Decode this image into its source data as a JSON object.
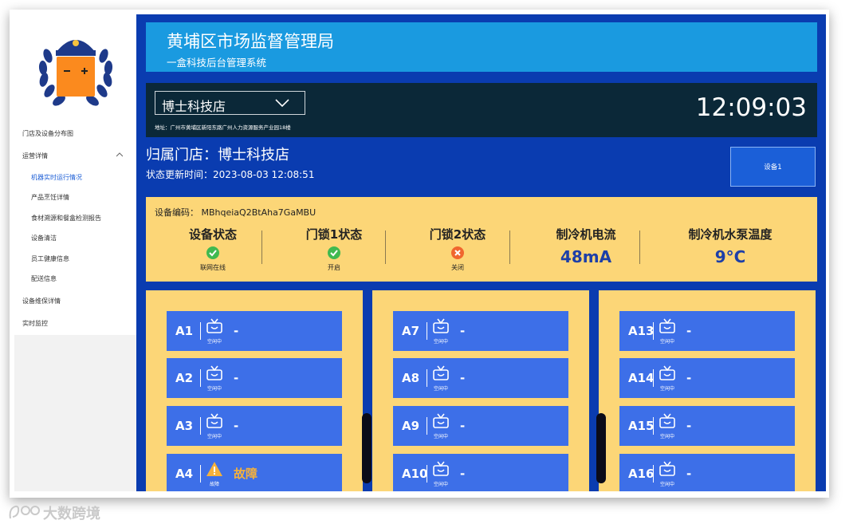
{
  "sidebar": {
    "items": [
      {
        "label": "门店及设备分布图",
        "level": 1,
        "active": false
      },
      {
        "label": "运营详情",
        "level": 1,
        "active": false,
        "expanded": true
      },
      {
        "label": "机器实时运行情况",
        "level": 2,
        "active": true
      },
      {
        "label": "产品烹饪详情",
        "level": 2,
        "active": false
      },
      {
        "label": "食材溯源和餐盒检测报告",
        "level": 2,
        "active": false
      },
      {
        "label": "设备清洁",
        "level": 2,
        "active": false
      },
      {
        "label": "员工健康信息",
        "level": 2,
        "active": false
      },
      {
        "label": "配送信息",
        "level": 2,
        "active": false
      },
      {
        "label": "设备维保详情",
        "level": 1,
        "active": false
      },
      {
        "label": "实时监控",
        "level": 1,
        "active": false
      }
    ]
  },
  "header": {
    "title": "黄埔区市场监督管理局",
    "subtitle": "一盒科技后台管理系统"
  },
  "store_bar": {
    "selected_store": "博士科技店",
    "address": "地址：广州市黄埔区新阳东路广州人力资源服务产业园18楼",
    "time": "12:09:03"
  },
  "store_info": {
    "store_title": "归属门店：博士科技店",
    "update_time": "状态更新时间：2023-08-03 12:08:51",
    "device_button": "设备1"
  },
  "device_status": {
    "code_text": "设备编码：  MBhqeiaQ2BtAha7GaMBU",
    "columns": [
      {
        "title": "设备状态",
        "status": "联网在线",
        "icon": "check-circle-icon"
      },
      {
        "title": "门锁1状态",
        "status": "开启",
        "icon": "check-circle-icon"
      },
      {
        "title": "门锁2状态",
        "status": "关闭",
        "icon": "x-circle-icon"
      },
      {
        "title": "制冷机电流",
        "value": "48mA"
      },
      {
        "title": "制冷机水泵温度",
        "value": "9°C"
      }
    ]
  },
  "slots": [
    {
      "label": "A1",
      "icon": "tv-icon",
      "status": "空闲中",
      "value": "-"
    },
    {
      "label": "A2",
      "icon": "tv-icon",
      "status": "空闲中",
      "value": "-"
    },
    {
      "label": "A3",
      "icon": "tv-icon",
      "status": "空闲中",
      "value": "-"
    },
    {
      "label": "A4",
      "icon": "warning-icon",
      "status": "故障",
      "value": "故障"
    },
    {
      "label": "A7",
      "icon": "tv-icon",
      "status": "空闲中",
      "value": "-"
    },
    {
      "label": "A8",
      "icon": "tv-icon",
      "status": "空闲中",
      "value": "-"
    },
    {
      "label": "A9",
      "icon": "tv-icon",
      "status": "空闲中",
      "value": "-"
    },
    {
      "label": "A10",
      "icon": "tv-icon",
      "status": "空闲中",
      "value": "-"
    },
    {
      "label": "A13",
      "icon": "tv-icon",
      "status": "空闲中",
      "value": "-"
    },
    {
      "label": "A14",
      "icon": "tv-icon",
      "status": "空闲中",
      "value": "-"
    },
    {
      "label": "A15",
      "icon": "tv-icon",
      "status": "空闲中",
      "value": "-"
    },
    {
      "label": "A16",
      "icon": "tv-icon",
      "status": "空闲中",
      "value": "-"
    }
  ],
  "watermark": {
    "text": "大数跨境"
  },
  "colors": {
    "main_bg": "#0a3cb0",
    "header_bg": "#1a9ae0",
    "panel_yellow": "#fcd677",
    "slot_blue": "#3d6fe8",
    "ok_green": "#3fb950",
    "error_orange": "#f0662e",
    "fault_text": "#f5b13b",
    "active_nav": "#1e5fd6"
  }
}
